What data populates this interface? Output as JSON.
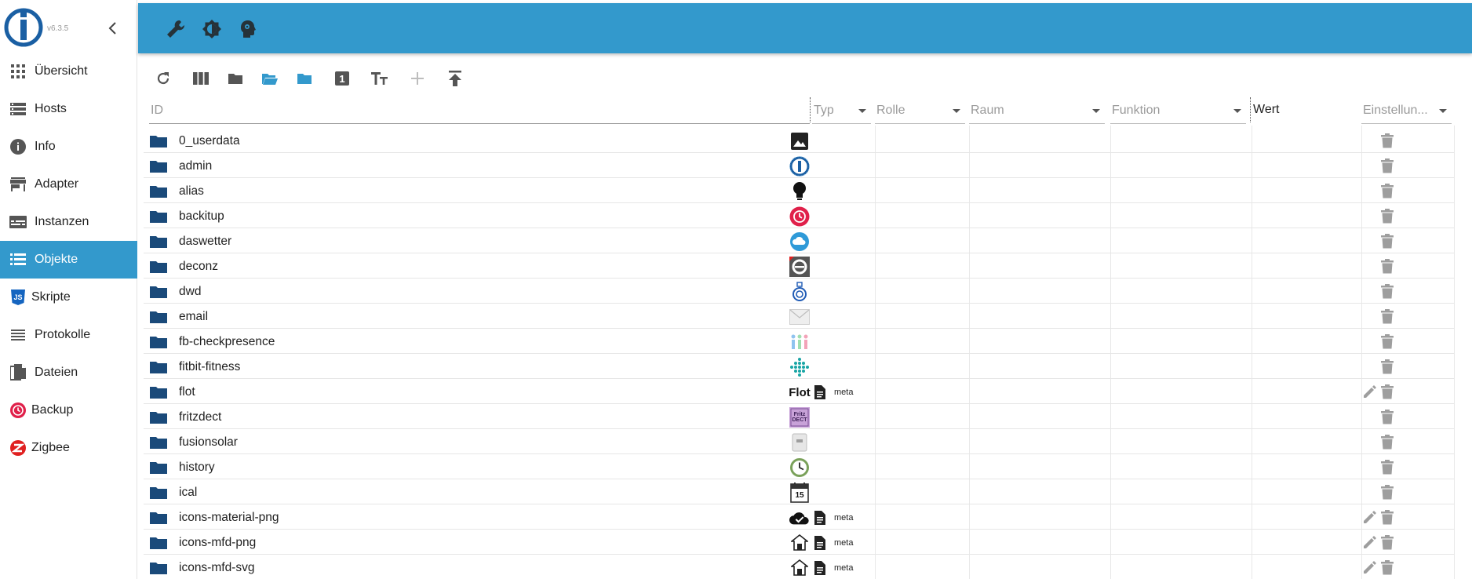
{
  "app": {
    "version": "v6.3.5"
  },
  "colors": {
    "primary": "#3399cc",
    "folder": "#1a4a7a",
    "backup_red": "#e0204a"
  },
  "sidebar": {
    "items": [
      {
        "label": "Übersicht",
        "icon": "apps-grid-icon",
        "active": false
      },
      {
        "label": "Hosts",
        "icon": "hosts-list-icon",
        "active": false
      },
      {
        "label": "Info",
        "icon": "info-icon",
        "active": false
      },
      {
        "label": "Adapter",
        "icon": "store-icon",
        "active": false
      },
      {
        "label": "Instanzen",
        "icon": "instances-icon",
        "active": false
      },
      {
        "label": "Objekte",
        "icon": "objects-list-icon",
        "active": true
      },
      {
        "label": "Skripte",
        "icon": "javascript-icon",
        "active": false
      },
      {
        "label": "Protokolle",
        "icon": "log-lines-icon",
        "active": false
      },
      {
        "label": "Dateien",
        "icon": "files-icon",
        "active": false
      },
      {
        "label": "Backup",
        "icon": "backup-icon",
        "active": false
      },
      {
        "label": "Zigbee",
        "icon": "zigbee-icon",
        "active": false
      }
    ]
  },
  "topbar": {
    "icons": [
      "wrench-icon",
      "theme-brightness-icon",
      "expert-mode-icon"
    ]
  },
  "toolbar": {
    "icons": [
      "refresh-icon",
      "columns-icon",
      "folder-icon",
      "folder-open-icon",
      "folder-blue-icon",
      "number-one-icon",
      "text-size-icon",
      "add-icon",
      "upload-icon"
    ]
  },
  "columns": {
    "id": "ID",
    "typ": "Typ",
    "rolle": "Rolle",
    "raum": "Raum",
    "funktion": "Funktion",
    "wert": "Wert",
    "einstellungen": "Einstellun..."
  },
  "rows": [
    {
      "name": "0_userdata",
      "icon": "image-icon",
      "meta": "",
      "editable": false
    },
    {
      "name": "admin",
      "icon": "iobroker-admin-icon",
      "meta": "",
      "editable": false
    },
    {
      "name": "alias",
      "icon": "lightbulb-icon",
      "meta": "",
      "editable": false
    },
    {
      "name": "backitup",
      "icon": "backitup-icon",
      "meta": "",
      "editable": false
    },
    {
      "name": "daswetter",
      "icon": "weather-cloud-icon",
      "meta": "",
      "editable": false
    },
    {
      "name": "deconz",
      "icon": "deconz-icon",
      "meta": "",
      "editable": false
    },
    {
      "name": "dwd",
      "icon": "dwd-icon",
      "meta": "",
      "editable": false
    },
    {
      "name": "email",
      "icon": "envelope-icon",
      "meta": "",
      "editable": false
    },
    {
      "name": "fb-checkpresence",
      "icon": "people-presence-icon",
      "meta": "",
      "editable": false
    },
    {
      "name": "fitbit-fitness",
      "icon": "fitbit-icon",
      "meta": "",
      "editable": false
    },
    {
      "name": "flot",
      "icon": "flot-icon",
      "icon_text": "Flot",
      "meta": "meta",
      "editable": true
    },
    {
      "name": "fritzdect",
      "icon": "fritzdect-icon",
      "icon_text": "Fritz DECT",
      "meta": "",
      "editable": false
    },
    {
      "name": "fusionsolar",
      "icon": "inverter-icon",
      "meta": "",
      "editable": false
    },
    {
      "name": "history",
      "icon": "history-clock-icon",
      "meta": "",
      "editable": false
    },
    {
      "name": "ical",
      "icon": "calendar-icon",
      "icon_text": "15",
      "meta": "",
      "editable": false
    },
    {
      "name": "icons-material-png",
      "icon": "cloud-check-icon",
      "meta": "meta",
      "editable": true
    },
    {
      "name": "icons-mfd-png",
      "icon": "house-icon",
      "meta": "meta",
      "editable": true
    },
    {
      "name": "icons-mfd-svg",
      "icon": "house-icon",
      "meta": "meta",
      "editable": true
    }
  ]
}
